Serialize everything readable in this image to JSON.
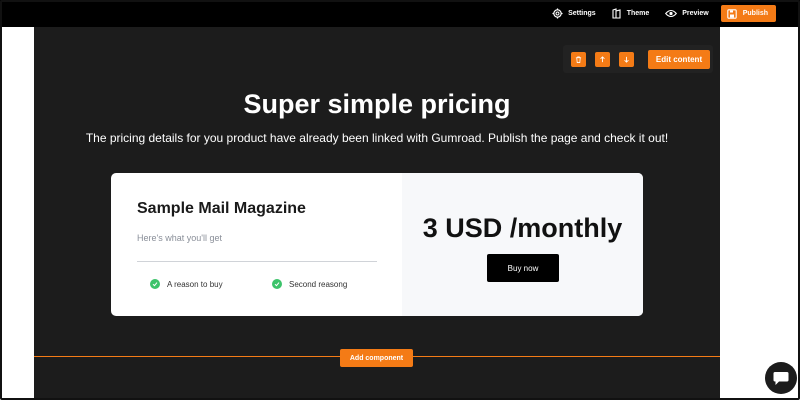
{
  "toolbar": {
    "settings_label": "Settings",
    "theme_label": "Theme",
    "preview_label": "Preview",
    "publish_label": "Publish",
    "icons": [
      "gear-icon",
      "theme-icon",
      "eye-icon",
      "save-icon"
    ]
  },
  "section_controls": {
    "icons": [
      "trash-icon",
      "arrow-up-icon",
      "arrow-down-icon"
    ],
    "edit_label": "Edit content"
  },
  "hero": {
    "title": "Super simple pricing",
    "subtitle": "The pricing details for you product have already been linked with Gumroad. Publish the page and check it out!"
  },
  "pricing_card": {
    "product_name": "Sample Mail Magazine",
    "description": "Here's what you'll get",
    "features": [
      "A reason to buy",
      "Second reasong"
    ],
    "price": "3 USD /monthly",
    "buy_label": "Buy now"
  },
  "add_component_label": "Add component",
  "colors": {
    "accent": "#f47b16",
    "section_bg": "#1c1c1c",
    "check": "#3cc36a"
  }
}
